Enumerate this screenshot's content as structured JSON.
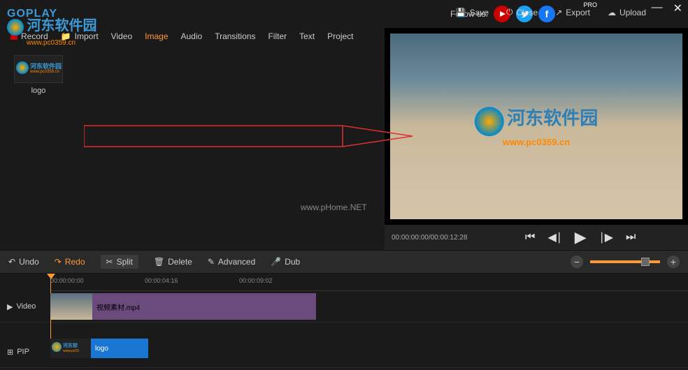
{
  "brand": "GOPLAY",
  "pro": "PRO",
  "follow_label": "Follow us:",
  "top": {
    "save": "Save",
    "close": "Close",
    "export": "Export",
    "upload": "Upload"
  },
  "tabs": {
    "record": "Record",
    "import": "Import",
    "video": "Video",
    "image": "Image",
    "audio": "Audio",
    "transitions": "Transitions",
    "filter": "Filter",
    "text": "Text",
    "project": "Project"
  },
  "asset": {
    "label": "logo"
  },
  "watermark": {
    "cn": "河东软件园",
    "url": "www.pc0359.cn",
    "phome": "www.pHome.NET"
  },
  "playback": {
    "time": "00:00:00:00/00:00:12:28"
  },
  "tools": {
    "undo": "Undo",
    "redo": "Redo",
    "split": "Split",
    "delete": "Delete",
    "advanced": "Advanced",
    "dub": "Dub"
  },
  "ruler": {
    "t0": "00:00:00:00",
    "t1": "00:00:04:16",
    "t2": "00:00:09:02"
  },
  "tracks": {
    "video": "Video",
    "pip": "PIP"
  },
  "clips": {
    "video_name": "视频素材.mp4",
    "pip_name": "logo"
  },
  "chart_data": {
    "type": "table",
    "timeline": {
      "duration_seconds": 12.28,
      "ruler_marks": [
        "00:00:00:00",
        "00:00:04:16",
        "00:00:09:02"
      ],
      "tracks": [
        {
          "name": "Video",
          "clips": [
            {
              "label": "视频素材.mp4",
              "start": 0,
              "approx_end": 12.28,
              "color": "#6b4a7c"
            }
          ]
        },
        {
          "name": "PIP",
          "clips": [
            {
              "label": "logo",
              "start": 0,
              "approx_end": 4.5,
              "color": "#1976d2"
            }
          ]
        }
      ]
    }
  }
}
